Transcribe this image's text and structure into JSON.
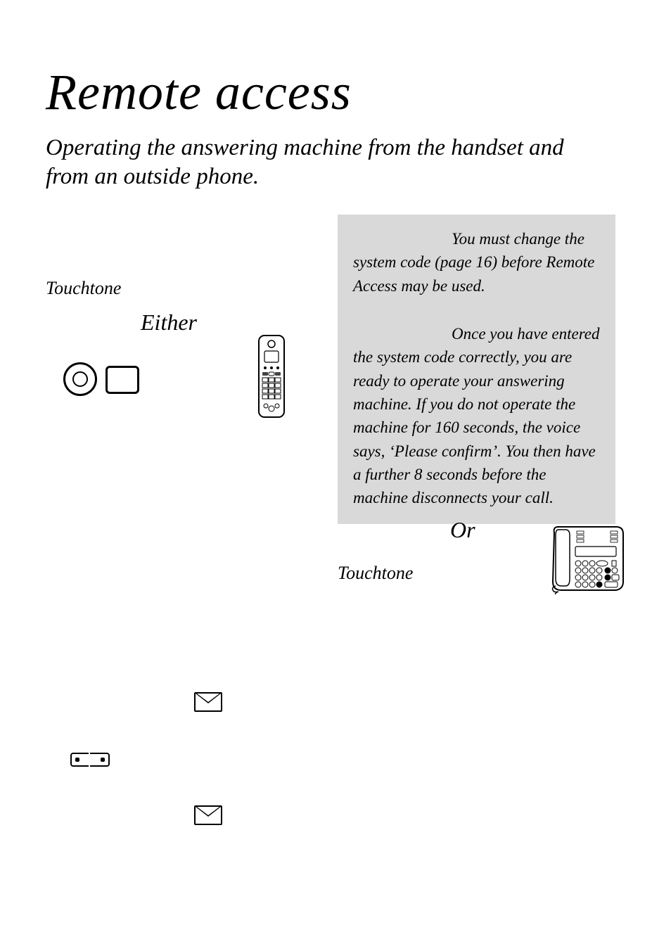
{
  "title": "Remote access",
  "subtitle": "Operating the answering machine from the handset and from an outside phone.",
  "touchtone1": "Touchtone",
  "either": "Either",
  "note1": "You must change the system code (page 16) before Remote Access may be used.",
  "note2": "Once you have entered the system code correctly, you are ready to operate your answering machine. If you do not operate the machine for 160 seconds, the voice says, ‘Please confirm’. You then have a further 8 seconds before the machine disconnects your call.",
  "or": "Or",
  "touchtone2": "Touchtone"
}
